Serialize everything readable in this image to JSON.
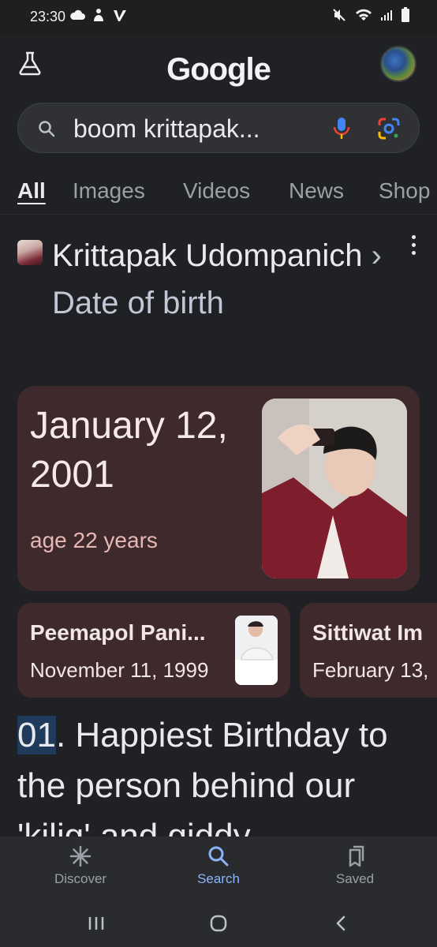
{
  "status_bar": {
    "time": "23:30"
  },
  "header": {
    "logo_text": "Google"
  },
  "search": {
    "query": "boom krittapak..."
  },
  "tabs": [
    {
      "label": "All",
      "active": true
    },
    {
      "label": "Images"
    },
    {
      "label": "Videos"
    },
    {
      "label": "News"
    },
    {
      "label": "Shop"
    }
  ],
  "result": {
    "entity_name": "Krittapak Udompanich",
    "separator": "›",
    "attribute": "Date of birth"
  },
  "answer": {
    "date_line1": "January 12,",
    "date_line2": "2001",
    "age": "age 22 years"
  },
  "related": [
    {
      "name": "Peemapol Pani...",
      "date": "November 11, 1999"
    },
    {
      "name": "Sittiwat Im",
      "date": "February 13,"
    }
  ],
  "snippet": {
    "highlight": "01",
    "rest": ". Happiest Birthday to the person behind our 'kilig' and  giddy"
  },
  "bottom_nav": [
    {
      "label": "Discover",
      "icon": "asterisk-icon"
    },
    {
      "label": "Search",
      "icon": "search-icon",
      "active": true
    },
    {
      "label": "Saved",
      "icon": "bookmarks-icon"
    }
  ],
  "colors": {
    "background": "#202124",
    "card": "#3e2a2c",
    "accent_blue": "#8ab4f8",
    "age_text": "#e6b7b3"
  }
}
